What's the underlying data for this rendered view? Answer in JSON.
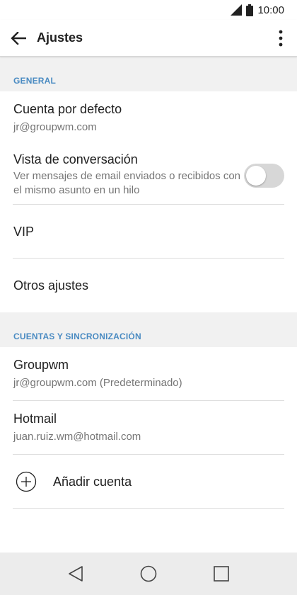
{
  "status_bar": {
    "time": "10:00"
  },
  "app_bar": {
    "title": "Ajustes"
  },
  "sections": {
    "general": {
      "header": "GENERAL",
      "items": [
        {
          "primary": "Cuenta por defecto",
          "secondary": "jr@groupwm.com"
        },
        {
          "primary": "Vista de conversación",
          "secondary": "Ver mensajes de email enviados o recibidos con el mismo asunto en un hilo",
          "toggle_on": false
        },
        {
          "primary": "VIP"
        },
        {
          "primary": "Otros ajustes"
        }
      ]
    },
    "accounts": {
      "header": "CUENTAS Y SINCRONIZACIÓN",
      "items": [
        {
          "primary": "Groupwm",
          "secondary": "jr@groupwm.com (Predeterminado)"
        },
        {
          "primary": "Hotmail",
          "secondary": "juan.ruiz.wm@hotmail.com"
        }
      ],
      "add_account_label": "Añadir cuenta"
    }
  },
  "colors": {
    "accent": "#4a8bc2",
    "section_bg": "#f1f1f1",
    "nav_bg": "#ececec",
    "toggle_off": "#d7d7d7"
  },
  "icons": [
    "signal-icon",
    "battery-icon",
    "back-arrow-icon",
    "more-vert-icon",
    "add-circle-icon",
    "nav-back-icon",
    "nav-home-icon",
    "nav-recents-icon"
  ]
}
